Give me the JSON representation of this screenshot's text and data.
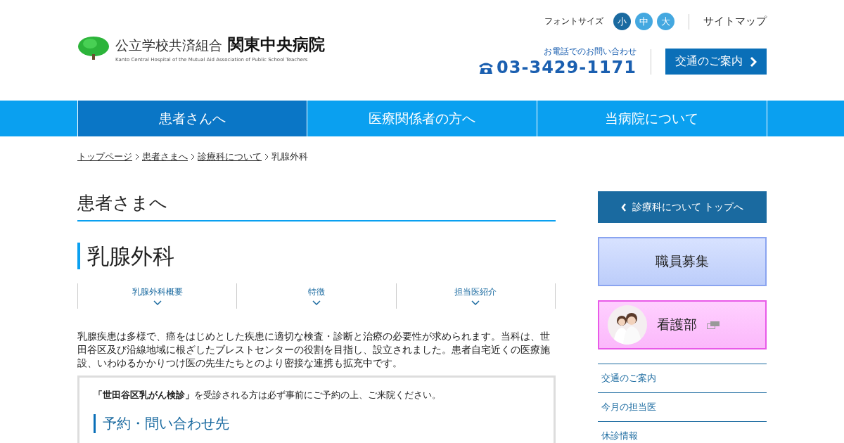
{
  "header": {
    "logo": {
      "org": "公立学校共済組合",
      "name": "関東中央病院",
      "english": "Kanto Central Hospital of the Mutual Aid Association of Public School Teachers"
    },
    "font_size": {
      "label": "フォントサイズ",
      "options": [
        {
          "label": "小",
          "selected": true
        },
        {
          "label": "中",
          "selected": false
        },
        {
          "label": "大",
          "selected": false
        }
      ]
    },
    "sitemap": "サイトマップ",
    "phone": {
      "caption": "お電話でのお問い合わせ",
      "number": "03-3429-1171"
    },
    "access_button": "交通のご案内"
  },
  "nav": [
    {
      "label": "患者さんへ",
      "selected": true
    },
    {
      "label": "医療関係者の方へ",
      "selected": false
    },
    {
      "label": "当病院について",
      "selected": false
    }
  ],
  "breadcrumb": {
    "links": [
      "トップページ",
      "患者さまへ",
      "診療科について"
    ],
    "current": "乳腺外科"
  },
  "main": {
    "section_title": "患者さまへ",
    "page_title": "乳腺外科",
    "anchors": [
      "乳腺外科概要",
      "特徴",
      "担当医紹介"
    ],
    "intro": "乳腺疾患は多様で、癌をはじめとした疾患に適切な検査・診断と治療の必要性が求められます。当科は、世田谷区及び沿線地域に根ざしたブレストセンターの役割を目指し、設立されました。患者自宅近くの医療施設、いわゆるかかりつけ医の先生たちとのより密接な連携も拡充中です。",
    "notice": "**「世田谷区乳がん検診」**を受診される方は必ず事前にご予約の上、ご来院ください。",
    "subheading": "予約・問い合わせ先"
  },
  "sidebar": {
    "back_button": "診療科について トップへ",
    "banners": [
      {
        "kind": "recruit",
        "label": "職員募集"
      },
      {
        "kind": "nursing",
        "label": "看護部"
      }
    ],
    "links": [
      "交通のご案内",
      "今月の担当医",
      "休診情報"
    ]
  }
}
